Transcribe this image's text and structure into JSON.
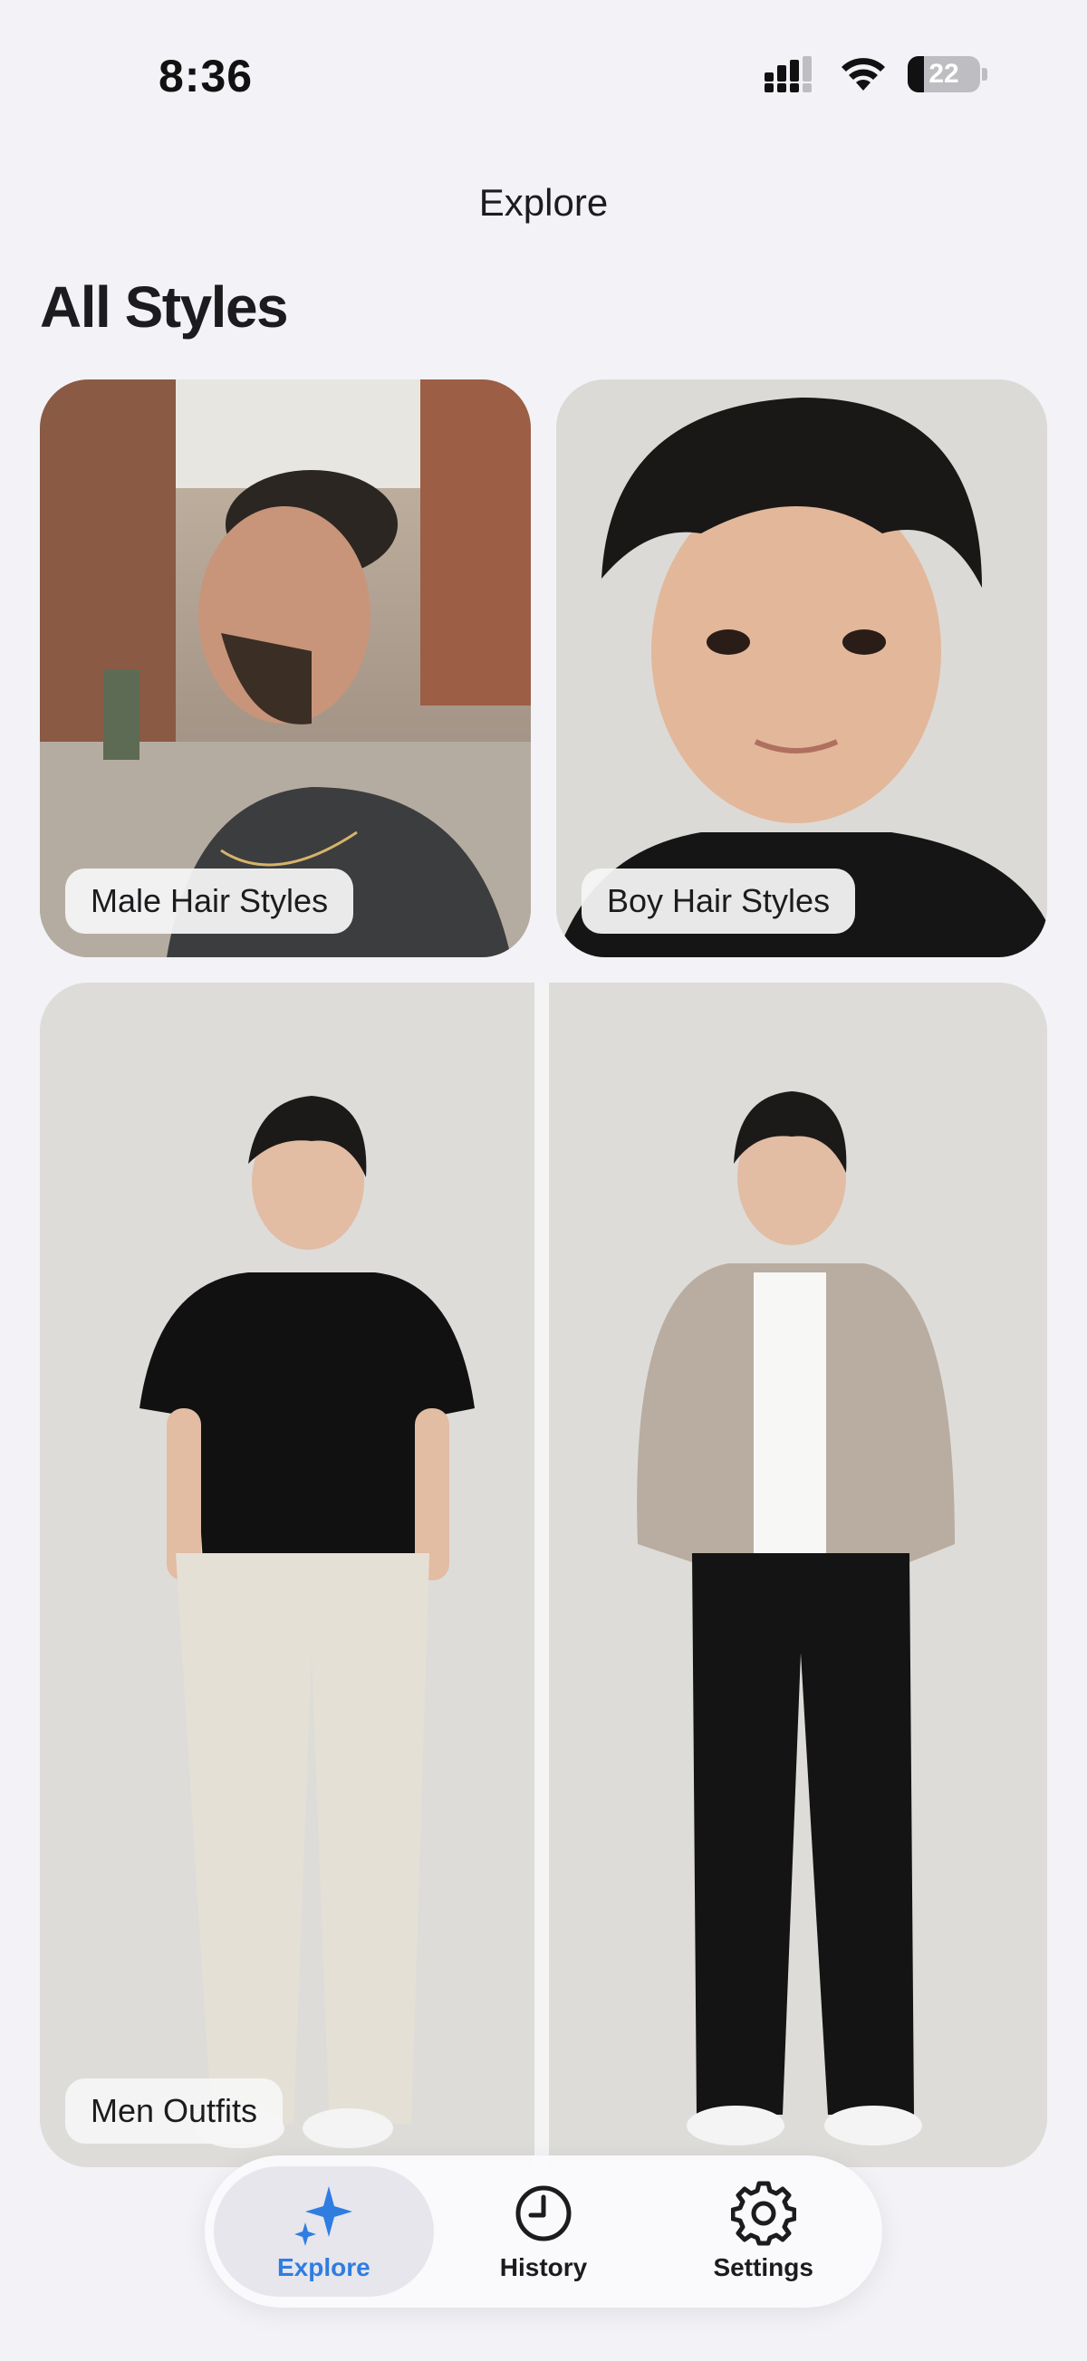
{
  "status_bar": {
    "time": "8:36",
    "battery_level": "22",
    "battery_fraction": 0.22,
    "icons": [
      "cellular-signal-icon",
      "wifi-icon",
      "battery-icon"
    ]
  },
  "nav": {
    "title": "Explore"
  },
  "section": {
    "title": "All Styles"
  },
  "cards": [
    {
      "label": "Male Hair Styles"
    },
    {
      "label": "Boy Hair Styles"
    },
    {
      "label": "Men Outfits"
    }
  ],
  "tab_bar": {
    "tabs": [
      {
        "label": "Explore",
        "icon": "sparkle-icon",
        "active": true
      },
      {
        "label": "History",
        "icon": "clock-icon",
        "active": false
      },
      {
        "label": "Settings",
        "icon": "gear-icon",
        "active": false
      }
    ],
    "accent_color": "#2f7de1"
  }
}
